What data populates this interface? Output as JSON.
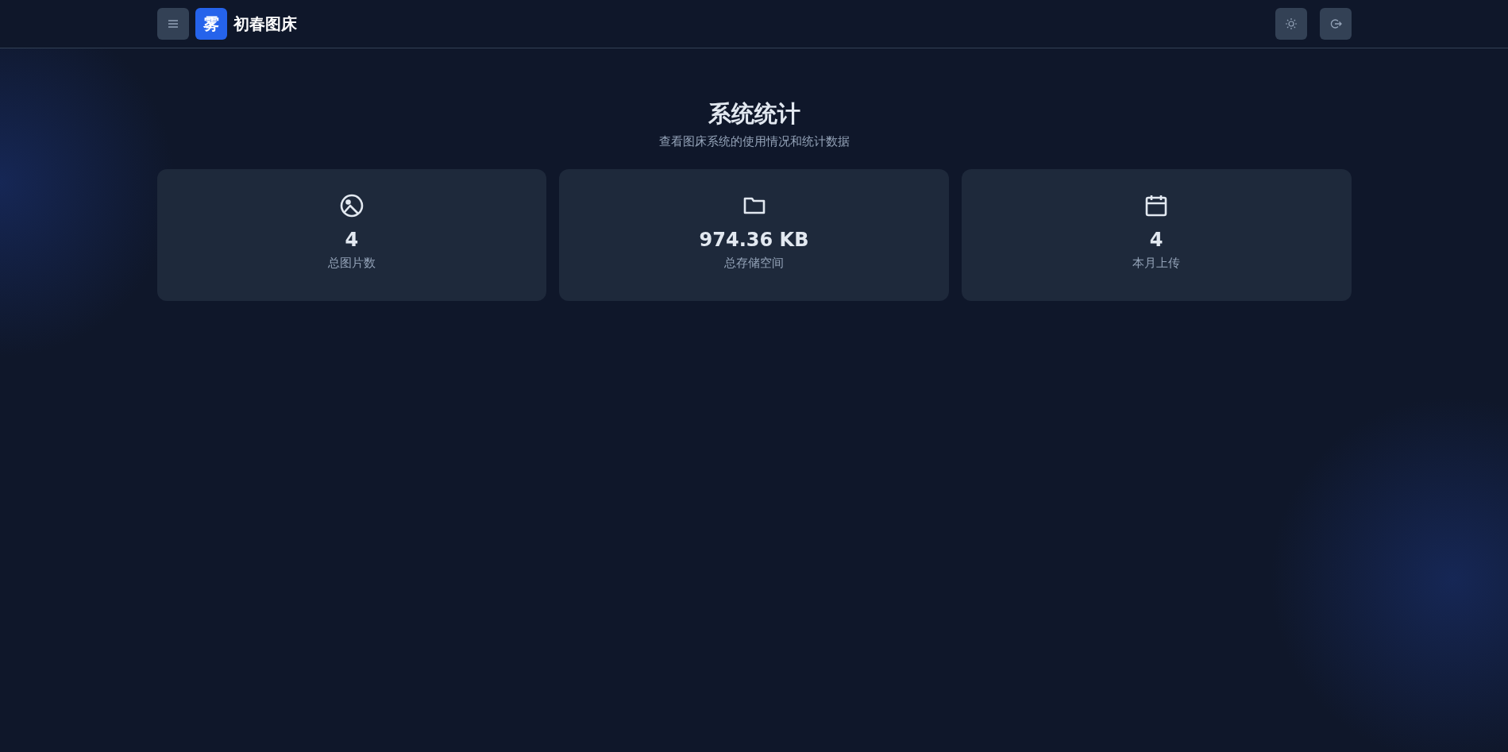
{
  "header": {
    "logo": "雾",
    "brand": "初春图床"
  },
  "page": {
    "title": "系统统计",
    "subtitle": "查看图床系统的使用情况和统计数据"
  },
  "stats": [
    {
      "kind": "image",
      "value": "4",
      "label": "总图片数"
    },
    {
      "kind": "folder",
      "value": "974.36 KB",
      "label": "总存储空间"
    },
    {
      "kind": "calendar",
      "value": "4",
      "label": "本月上传"
    }
  ]
}
